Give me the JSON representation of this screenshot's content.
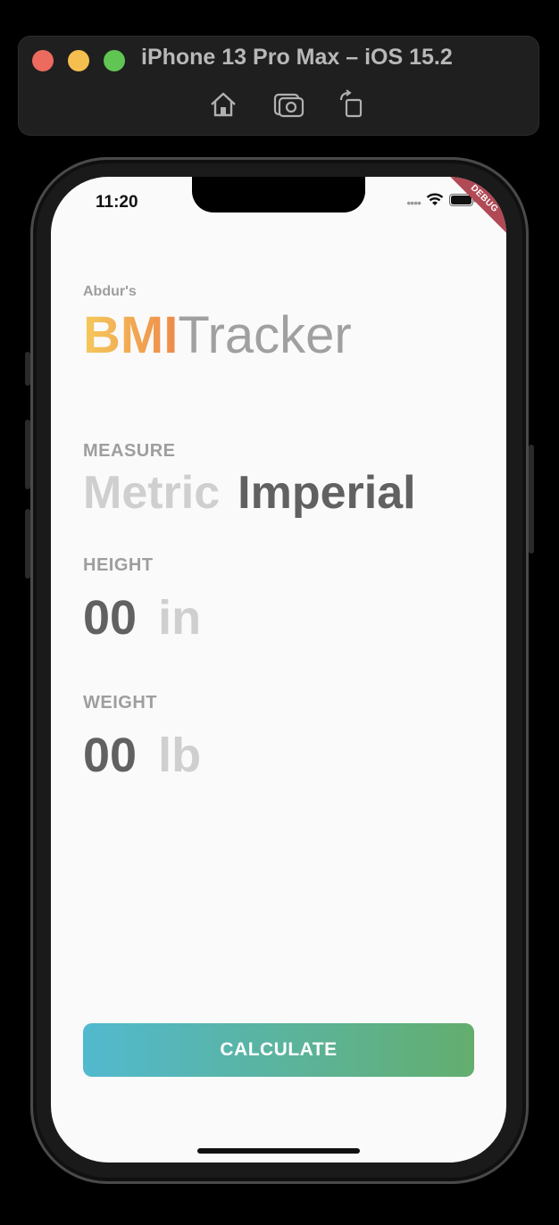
{
  "simulator": {
    "title": "iPhone 13 Pro Max – iOS 15.2",
    "tools": [
      "home-icon",
      "screenshot-icon",
      "rotate-icon"
    ]
  },
  "status_bar": {
    "time": "11:20",
    "debug_label": "DEBUG"
  },
  "brand": {
    "owner": "Abdur's",
    "primary": "BMI",
    "secondary": "Tracker"
  },
  "measure": {
    "label": "MEASURE",
    "options": [
      "Metric",
      "Imperial"
    ],
    "selected": "Imperial"
  },
  "height": {
    "label": "HEIGHT",
    "value": "00",
    "unit": "in"
  },
  "weight": {
    "label": "WEIGHT",
    "value": "00",
    "unit": "lb"
  },
  "actions": {
    "calculate_label": "CALCULATE"
  },
  "colors": {
    "gradient_bmi": [
      "#f5c95c",
      "#ee8a4a"
    ],
    "gradient_button": [
      "#52b9cf",
      "#63ae6e"
    ],
    "text_active": "#616161",
    "text_inactive": "#cfcfcf"
  }
}
